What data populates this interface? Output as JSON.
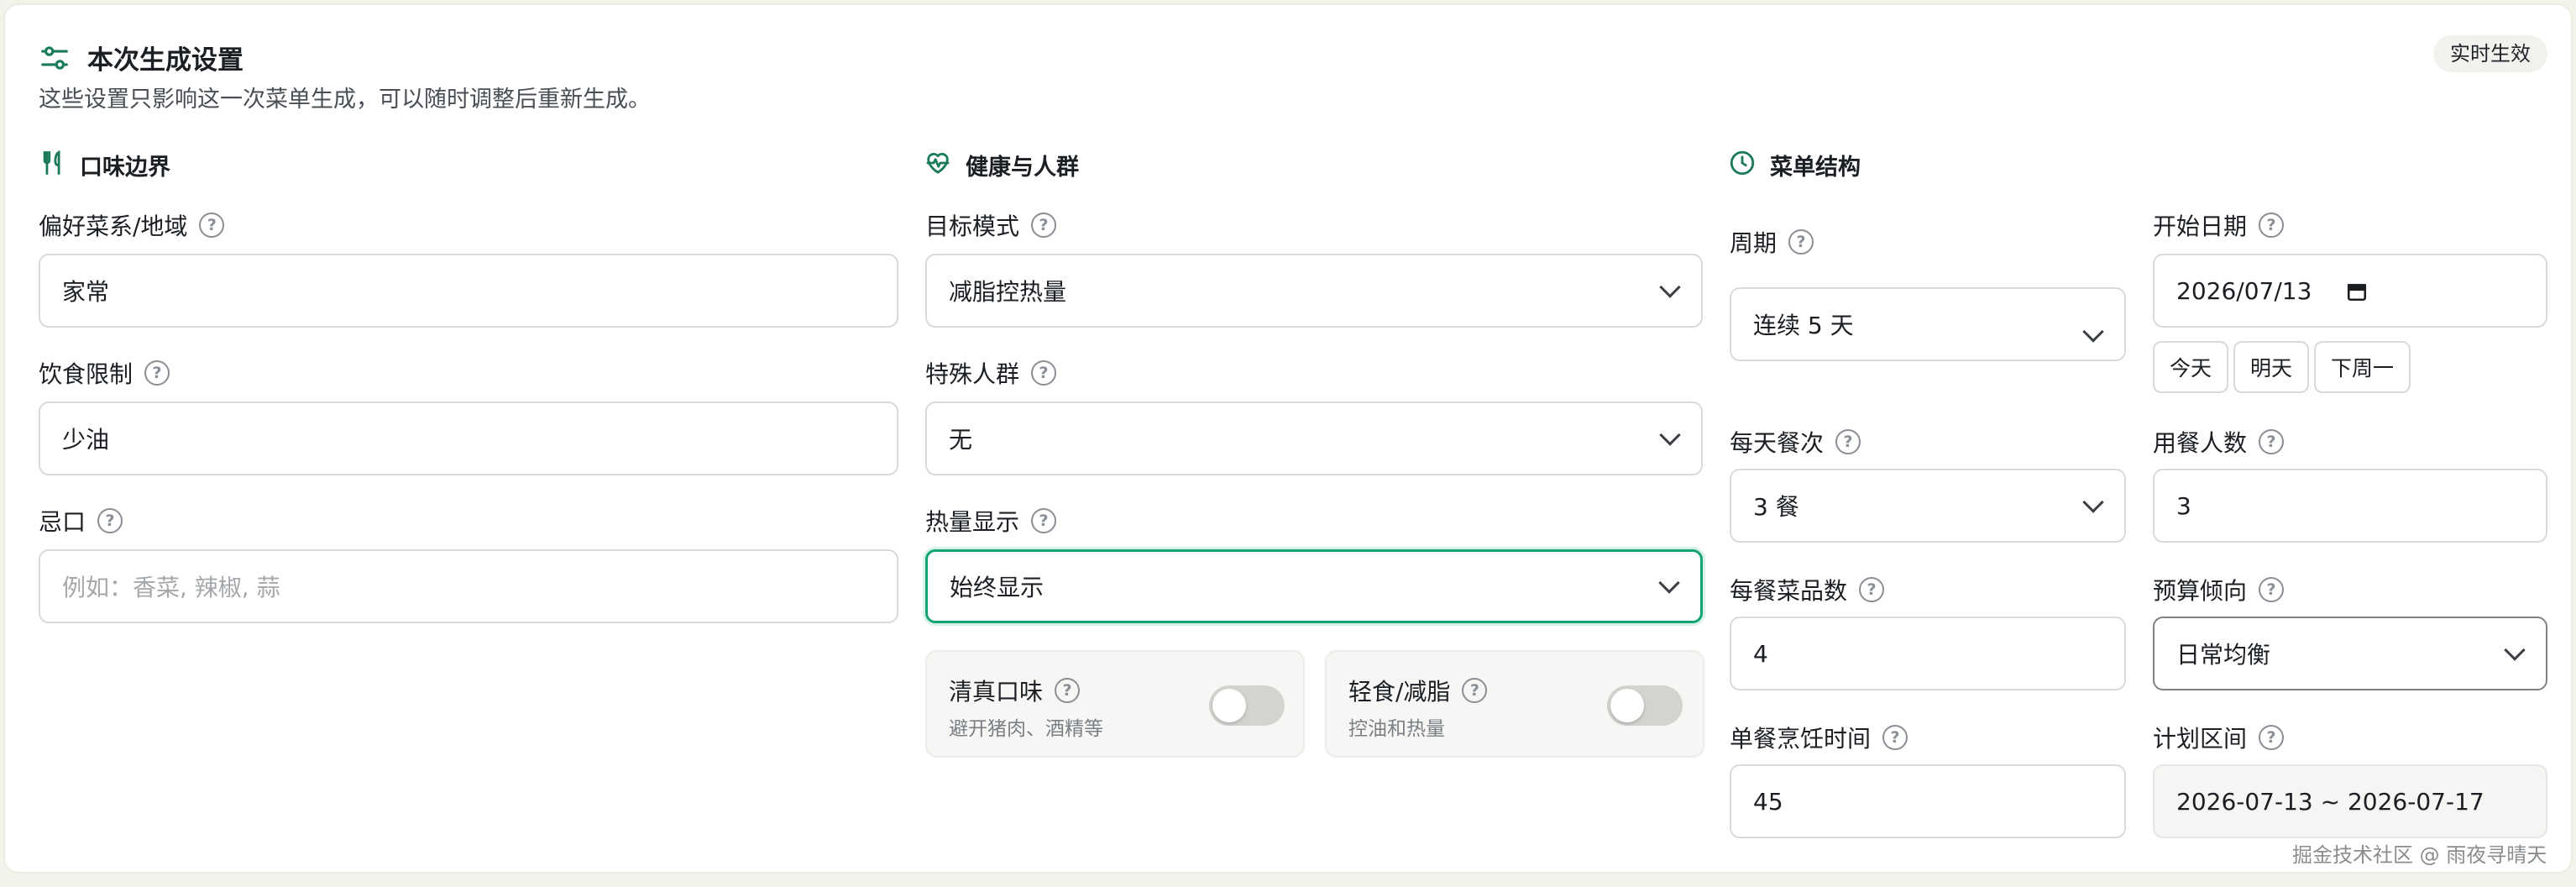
{
  "header": {
    "title": "本次生成设置",
    "description": "这些设置只影响这一次菜单生成，可以随时调整后重新生成。",
    "badge": "实时生效"
  },
  "colors": {
    "accent": "#16a272",
    "icon": "#1a7a5a",
    "border": "#d9dad6"
  },
  "taste": {
    "title": "口味边界",
    "icon": "utensils-icon",
    "cuisine_label": "偏好菜系/地域",
    "cuisine_value": "家常",
    "restriction_label": "饮食限制",
    "restriction_value": "少油",
    "avoid_label": "忌口",
    "avoid_placeholder": "例如：香菜, 辣椒, 蒜"
  },
  "health": {
    "title": "健康与人群",
    "icon": "heart-pulse-icon",
    "goal_label": "目标模式",
    "goal_value": "减脂控热量",
    "group_label": "特殊人群",
    "group_value": "无",
    "calorie_label": "热量显示",
    "calorie_value": "始终显示",
    "halal_title": "清真口味",
    "halal_sub": "避开猪肉、酒精等",
    "halal_on": false,
    "light_title": "轻食/减脂",
    "light_sub": "控油和热量",
    "light_on": false
  },
  "structure": {
    "title": "菜单结构",
    "icon": "clock-icon",
    "period_label": "周期",
    "period_value": "连续 5 天",
    "start_label": "开始日期",
    "start_value": "2026/07/13",
    "quick_dates": [
      "今天",
      "明天",
      "下周一"
    ],
    "meals_label": "每天餐次",
    "meals_value": "3 餐",
    "people_label": "用餐人数",
    "people_value": "3",
    "dishes_label": "每餐菜品数",
    "dishes_value": "4",
    "budget_label": "预算倾向",
    "budget_value": "日常均衡",
    "cook_label": "单餐烹饪时间",
    "cook_value": "45",
    "range_label": "计划区间",
    "range_value": "2026-07-13 ~ 2026-07-17"
  },
  "help_icon": "?",
  "watermark": "掘金技术社区 @ 雨夜寻晴天"
}
